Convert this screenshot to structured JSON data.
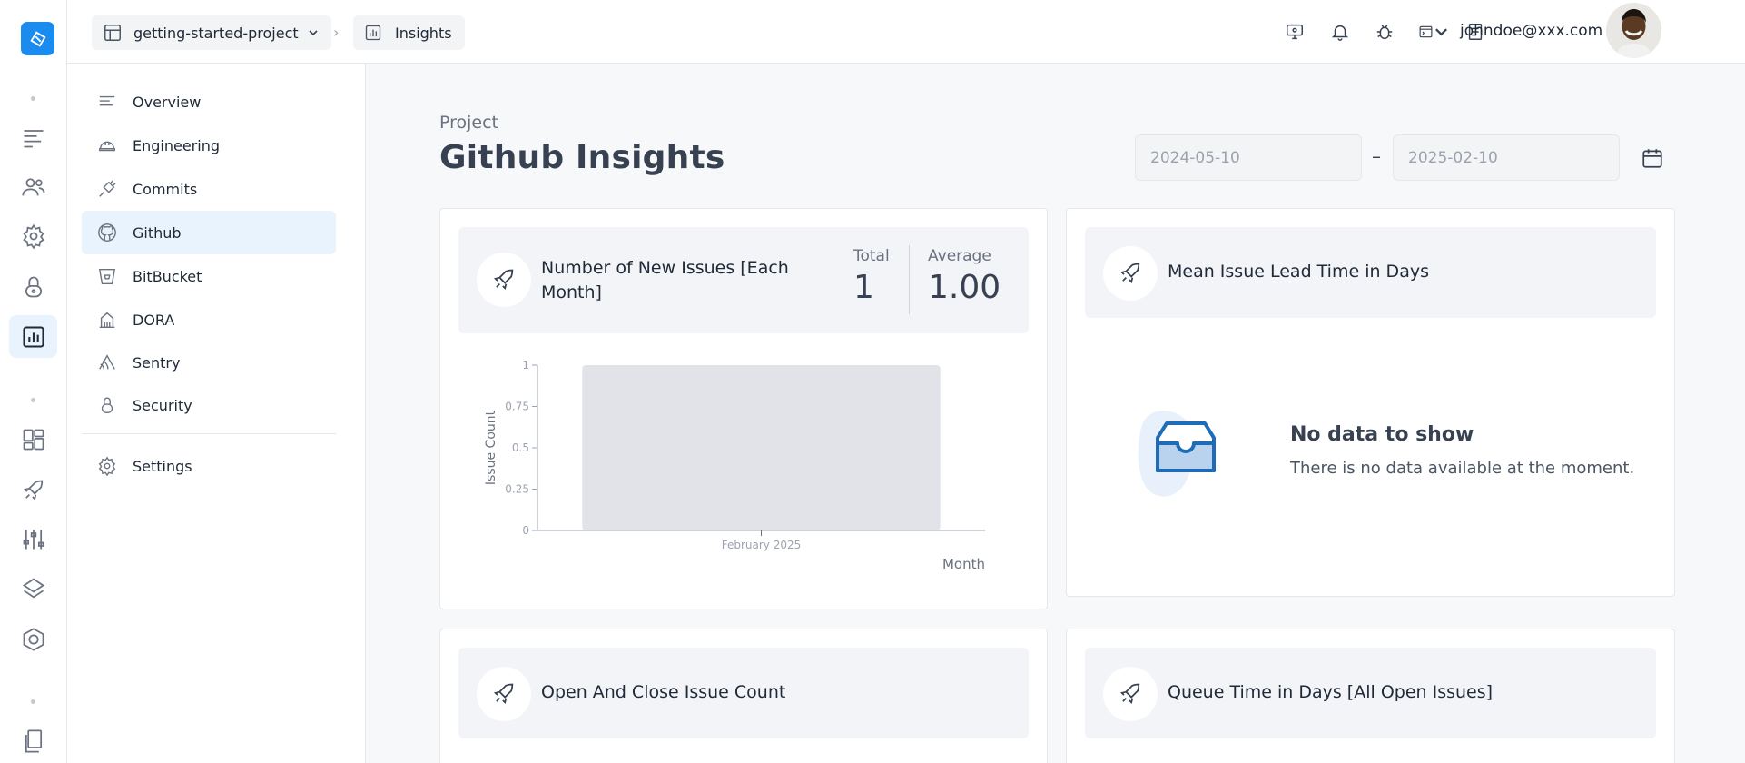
{
  "colors": {
    "accent": "#1a8cf0",
    "active_bg": "#e8f3fd",
    "bar": "#e1e3e9"
  },
  "rail": {
    "items": [
      {
        "name": "list-icon"
      },
      {
        "name": "users-icon"
      },
      {
        "name": "gear-icon"
      },
      {
        "name": "lock-icon"
      },
      {
        "name": "bar-chart-icon",
        "active": true
      },
      {
        "name": "grid-icon"
      },
      {
        "name": "rocket-icon"
      },
      {
        "name": "sliders-icon"
      },
      {
        "name": "layers-icon"
      },
      {
        "name": "badge-icon"
      },
      {
        "name": "documents-icon"
      }
    ]
  },
  "sidebar": {
    "items": [
      {
        "label": "Overview",
        "icon": "list-icon"
      },
      {
        "label": "Engineering",
        "icon": "hardhat-icon"
      },
      {
        "label": "Commits",
        "icon": "plug-icon"
      },
      {
        "label": "Github",
        "icon": "github-icon",
        "active": true
      },
      {
        "label": "BitBucket",
        "icon": "bitbucket-icon"
      },
      {
        "label": "DORA",
        "icon": "building-icon"
      },
      {
        "label": "Sentry",
        "icon": "sentry-icon"
      },
      {
        "label": "Security",
        "icon": "lock-icon"
      }
    ],
    "settings_label": "Settings"
  },
  "topbar": {
    "project": "getting-started-project",
    "page": "Insights",
    "separator": "›",
    "user_email": "johndoe@xxx.com",
    "icons": [
      "monitor-icon",
      "bell-icon",
      "bug-icon",
      "terminal-icon",
      "notes-icon"
    ]
  },
  "main": {
    "eyebrow": "Project",
    "title": "Github Insights",
    "date_from": "2024-05-10",
    "date_to": "2025-02-10",
    "date_dash": "–"
  },
  "cards": {
    "new_issues": {
      "title": "Number of New Issues [Each Month]",
      "total_label": "Total",
      "total_value": "1",
      "average_label": "Average",
      "average_value": "1.00"
    },
    "lead_time": {
      "title": "Mean Issue Lead Time in Days",
      "nodata_title": "No data to show",
      "nodata_text": "There is no data available at the moment."
    },
    "open_close": {
      "title": "Open And Close Issue Count"
    },
    "queue_time": {
      "title": "Queue Time in Days [All Open Issues]"
    }
  },
  "chart_data": {
    "type": "bar",
    "categories": [
      "February 2025"
    ],
    "values": [
      1
    ],
    "xlabel": "Month",
    "ylabel": "Issue Count",
    "ylim": [
      0,
      1
    ],
    "yticks": [
      "0",
      "0.25",
      "0.5",
      "0.75",
      "1"
    ],
    "grid": false,
    "legend": "none"
  }
}
